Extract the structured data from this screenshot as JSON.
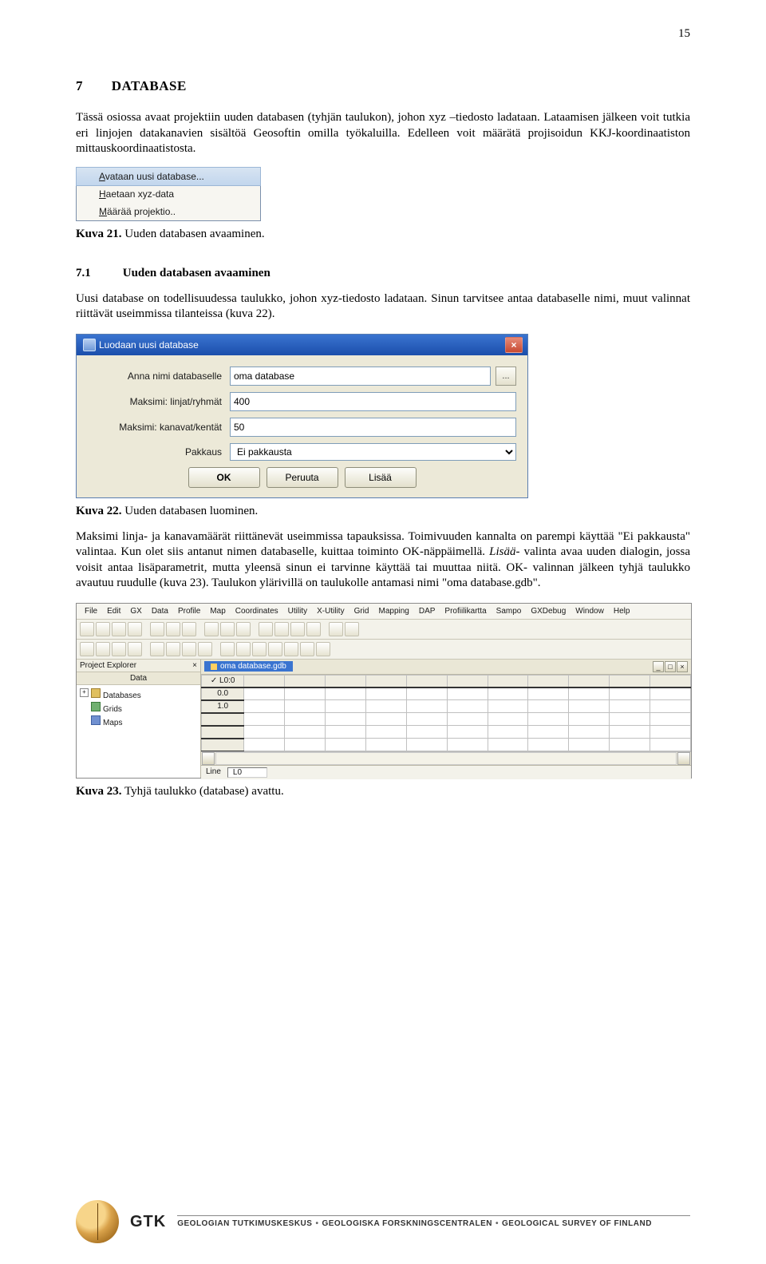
{
  "page_number": "15",
  "section": {
    "number": "7",
    "title": "DATABASE"
  },
  "para1": "Tässä osiossa avaat projektiin uuden databasen (tyhjän taulukon), johon xyz –tiedosto ladataan. Lataamisen jälkeen voit tutkia eri linjojen datakanavien sisältöä Geosoftin omilla työkaluilla. Edelleen voit määrätä projisoidun KKJ-koordinaatiston mittauskoordinaatistosta.",
  "kuva21": {
    "caption_num": "Kuva 21.",
    "caption_text": " Uuden databasen avaaminen.",
    "menu": {
      "item1_pre": "",
      "item1_underline": "A",
      "item1_post": "vataan uusi database...",
      "item2_pre": "",
      "item2_underline": "H",
      "item2_post": "aetaan xyz-data",
      "item3_pre": "",
      "item3_underline": "M",
      "item3_post": "äärää projektio.."
    }
  },
  "subsection": {
    "number": "7.1",
    "title": "Uuden databasen avaaminen"
  },
  "para2": "Uusi database on todellisuudessa taulukko, johon xyz-tiedosto ladataan. Sinun tarvitsee antaa databaselle nimi, muut valinnat riittävät useimmissa tilanteissa (kuva 22).",
  "kuva22": {
    "caption_num": "Kuva 22.",
    "caption_text": " Uuden databasen luominen.",
    "title": "Luodaan uusi database",
    "labels": {
      "name": "Anna nimi databaselle",
      "lines": "Maksimi: linjat/ryhmät",
      "channels": "Maksimi: kanavat/kentät",
      "packing": "Pakkaus"
    },
    "values": {
      "name": "oma database",
      "lines": "400",
      "channels": "50",
      "packing": "Ei pakkausta"
    },
    "browse": "...",
    "buttons": {
      "ok": "OK",
      "cancel": "Peruuta",
      "more": "Lisää"
    }
  },
  "para3_a": "Maksimi linja- ja kanavamäärät riittänevät useimmissa tapauksissa. Toimivuuden kannalta on parempi käyttää \"Ei pakkausta\" valintaa. Kun olet siis antanut nimen databaselle, kuittaa toiminto OK-näppäimellä. ",
  "para3_b": "Lisää",
  "para3_c": "- valinta avaa uuden dialogin, jossa voisit antaa lisäparametrit, mutta yleensä sinun ei tarvinne käyttää tai muuttaa niitä. OK- valinnan jälkeen tyhjä taulukko avautuu ruudulle (kuva 23). Taulukon ylärivillä on taulukolle antamasi nimi \"oma database.gdb\".",
  "kuva23": {
    "caption_num": "Kuva 23.",
    "caption_text": " Tyhjä taulukko (database) avattu.",
    "menubar": [
      "File",
      "Edit",
      "GX",
      "Data",
      "Profile",
      "Map",
      "Coordinates",
      "Utility",
      "X-Utility",
      "Grid",
      "Mapping",
      "DAP",
      "Profiilikartta",
      "Sampo",
      "GXDebug",
      "Window",
      "Help"
    ],
    "explorer": {
      "title": "Project Explorer",
      "tab": "Data",
      "nodes": [
        "Databases",
        "Grids",
        "Maps"
      ]
    },
    "db_tab_title": "oma database.gdb",
    "sheet": {
      "corner": "✓ L0:0",
      "rows": [
        "0.0",
        "1.0"
      ]
    },
    "status": {
      "label": "Line",
      "editor": "L0"
    }
  },
  "footer": {
    "gtk": "GTK",
    "a": "GEOLOGIAN TUTKIMUSKESKUS",
    "b": "GEOLOGISKA FORSKNINGSCENTRALEN",
    "c": "GEOLOGICAL SURVEY OF FINLAND"
  }
}
